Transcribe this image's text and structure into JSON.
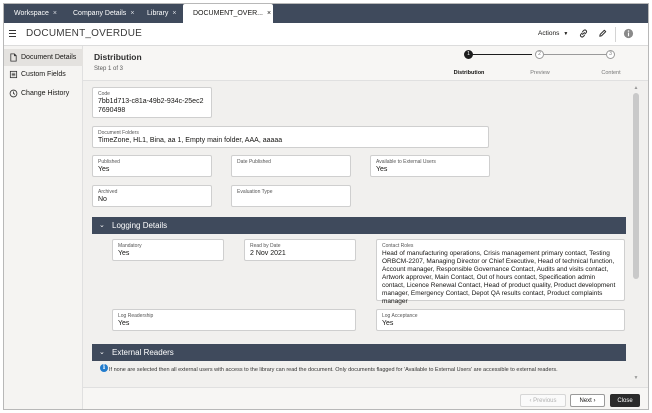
{
  "tabs": [
    {
      "label": "Workspace",
      "active": false
    },
    {
      "label": "Company Details",
      "active": false
    },
    {
      "label": "Library",
      "active": false
    },
    {
      "label": "DOCUMENT_OVER...",
      "active": true
    }
  ],
  "tab_close_glyph": "×",
  "header": {
    "title": "DOCUMENT_OVERDUE",
    "actions_label": "Actions",
    "icons": [
      "menu-icon",
      "link-icon",
      "edit-pencil-icon",
      "info-icon"
    ]
  },
  "nav": {
    "items": [
      {
        "label": "Document Details",
        "icon": "document-icon",
        "active": true
      },
      {
        "label": "Custom Fields",
        "icon": "list-icon",
        "active": false
      },
      {
        "label": "Change History",
        "icon": "history-icon",
        "active": false
      }
    ]
  },
  "step": {
    "title": "Distribution",
    "subtitle": "Step 1 of 3"
  },
  "train": [
    {
      "number": "1",
      "label": "Distribution",
      "active": true
    },
    {
      "number": "2",
      "label": "Preview",
      "active": false
    },
    {
      "number": "3",
      "label": "Content",
      "active": false
    }
  ],
  "fields": {
    "code": {
      "label": "Code",
      "value": "7bb1d713-c81a-49b2-934c-25ec27690498"
    },
    "folders": {
      "label": "Document Folders",
      "value": "TimeZone, HL1, Bina, aa 1, Empty main folder, AAA, aaaaa"
    },
    "published": {
      "label": "Published",
      "value": "Yes"
    },
    "date_published": {
      "label": "Date Published",
      "value": ""
    },
    "external": {
      "label": "Available to External Users",
      "value": "Yes"
    },
    "archived": {
      "label": "Archived",
      "value": "No"
    },
    "evaluation": {
      "label": "Evaluation Type",
      "value": ""
    }
  },
  "logging": {
    "section_title": "Logging Details",
    "mandatory": {
      "label": "Mandatory",
      "value": "Yes"
    },
    "read_by": {
      "label": "Read by Date",
      "value": "2 Nov 2021"
    },
    "contact_roles": {
      "label": "Contact Roles",
      "value": "Head of manufacturing operations, Crisis management primary contact, Testing ORBCM-2207, Managing Director or Chief Executive, Head of technical function, Account manager, Responsible Governance Contact, Audits and visits contact, Artwork approver, Main Contact, Out of hours contact, Specification admin contact, Licence Renewal Contact, Head of product quality, Product development manager, Emergency Contact, Depot QA results contact, Product complaints manager"
    },
    "log_readership": {
      "label": "Log Readership",
      "value": "Yes"
    },
    "log_acceptance": {
      "label": "Log Acceptance",
      "value": "Yes"
    }
  },
  "external_readers": {
    "section_title": "External Readers",
    "info_text": "If none are selected then all external users with access to the library can read the document. Only documents flagged for 'Available to External Users' are accessible to external readers."
  },
  "footer": {
    "previous_label": "Previous",
    "next_label": "Next",
    "close_label": "Close"
  },
  "colors": {
    "tabbar": "#3f4a5c",
    "section_header": "#3f4a5c",
    "info_blue": "#227ccd",
    "close_button": "#2b2b2b"
  }
}
